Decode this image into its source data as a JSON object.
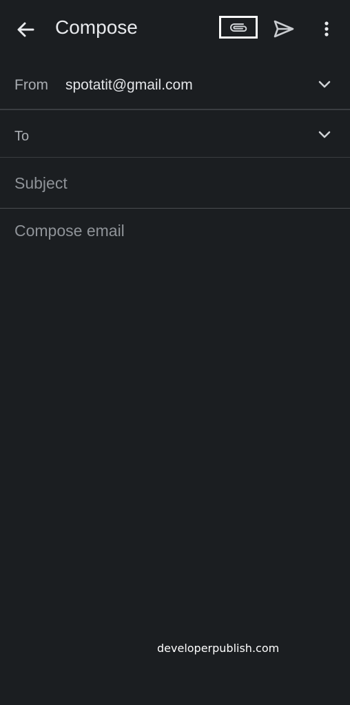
{
  "header": {
    "title": "Compose",
    "icons": {
      "back": "arrow-back-icon",
      "attach": "paperclip-icon",
      "send": "send-icon",
      "more": "more-vert-icon"
    }
  },
  "form": {
    "from_label": "From",
    "from_value": "spotatit@gmail.com",
    "to_label": "To",
    "to_value": "",
    "subject_placeholder": "Subject",
    "body_placeholder": "Compose email"
  },
  "watermark": "developerpublish.com",
  "colors": {
    "background": "#1b1e21",
    "divider": "#3a3d41",
    "text_primary": "#e8eaed",
    "text_secondary": "#8f9398",
    "highlight_box": "#ffffff"
  }
}
